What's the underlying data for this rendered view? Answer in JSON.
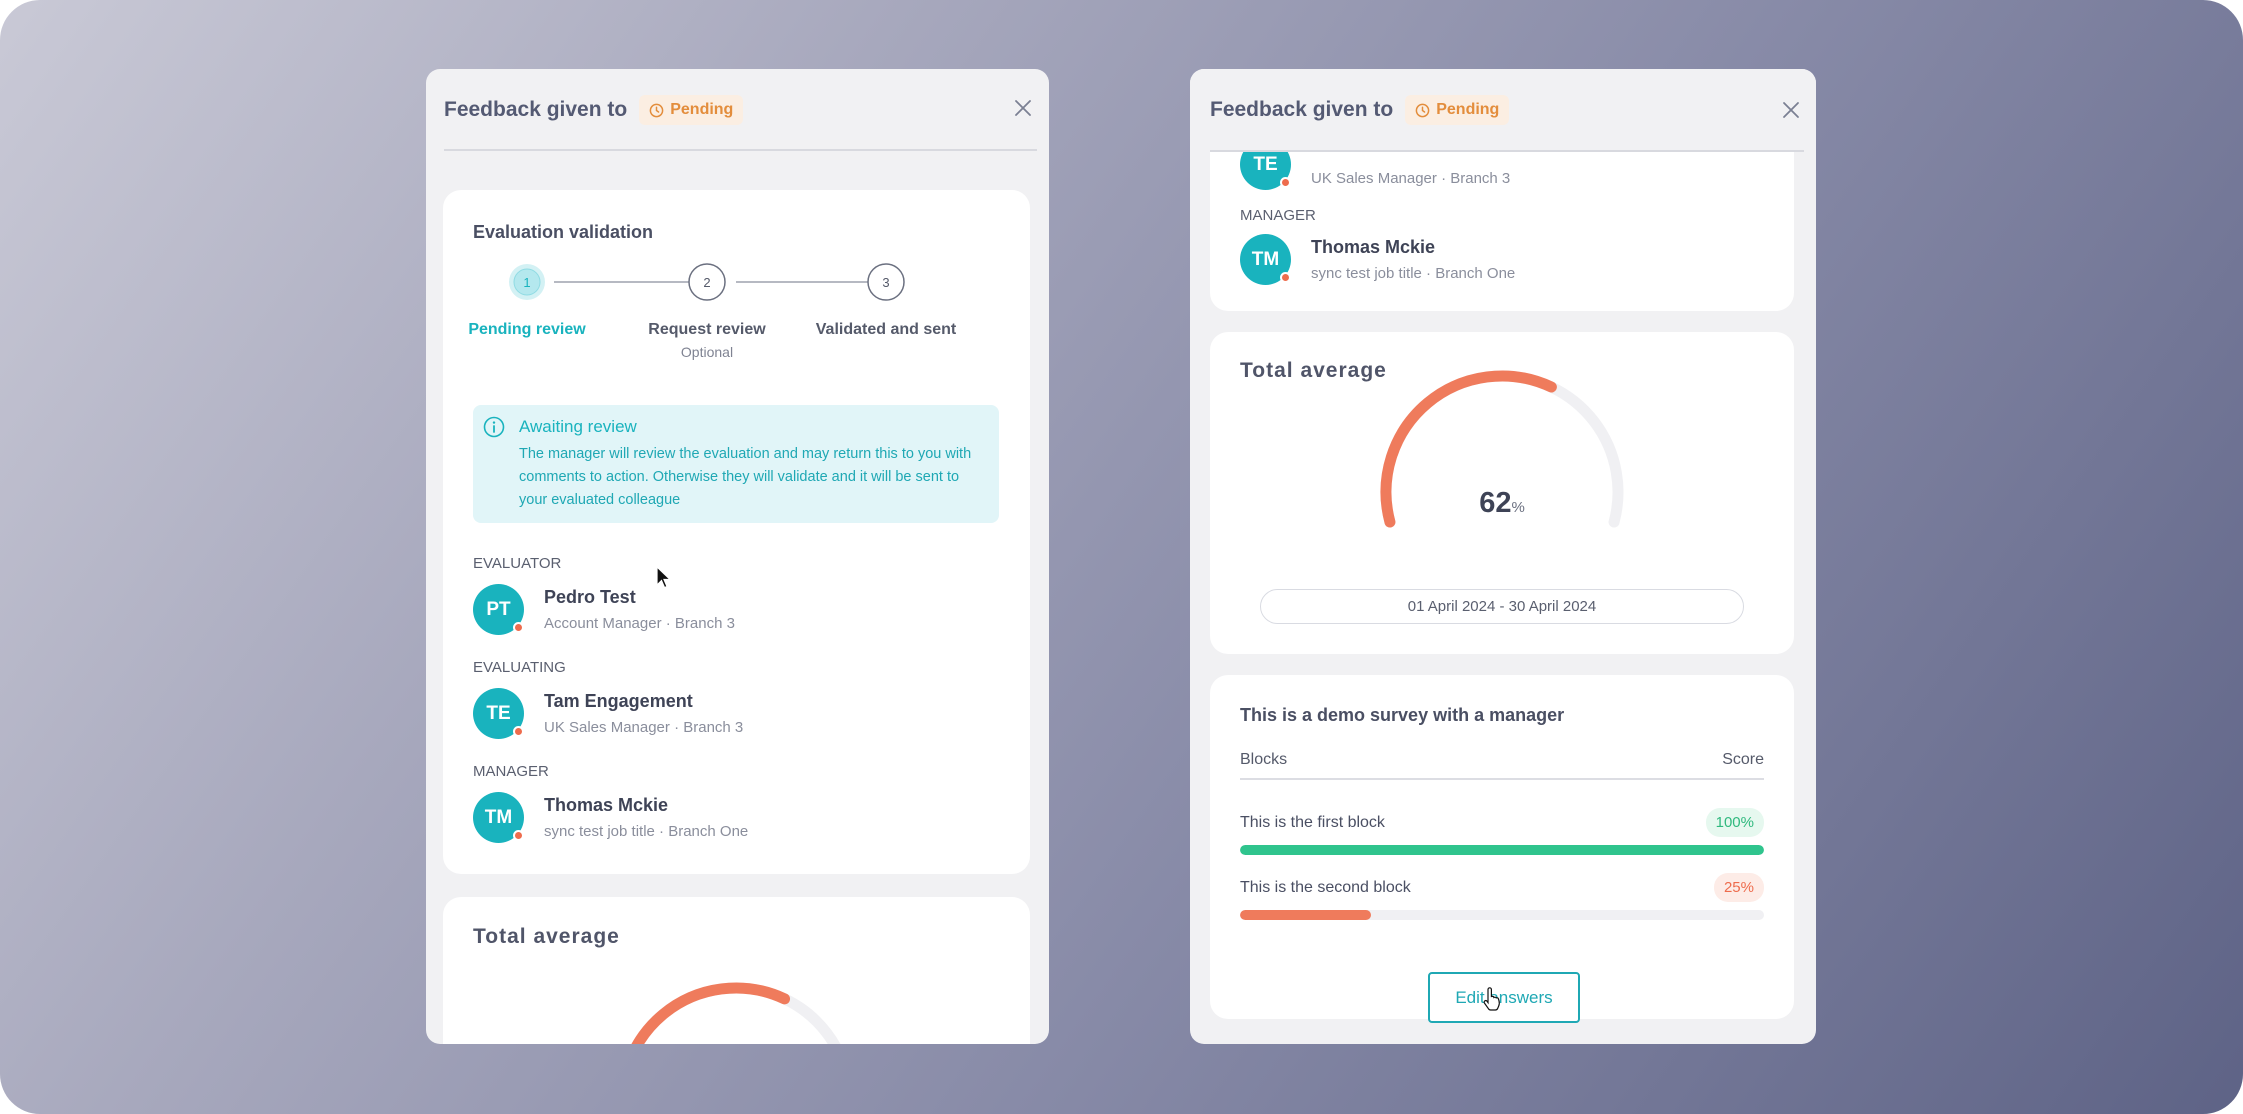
{
  "colors": {
    "accent": "#19b3be",
    "pending": "#e38d3c",
    "gauge": "#ef7b5c",
    "success": "#2fc48d",
    "danger": "#ee6c4d"
  },
  "left_panel": {
    "title": "Feedback given to",
    "status_badge": "Pending",
    "validation": {
      "title": "Evaluation validation",
      "steps": [
        {
          "number": "1",
          "label": "Pending review",
          "sub": "",
          "active": true
        },
        {
          "number": "2",
          "label": "Request review",
          "sub": "Optional",
          "active": false
        },
        {
          "number": "3",
          "label": "Validated and sent",
          "sub": "",
          "active": false
        }
      ],
      "alert": {
        "title": "Awaiting review",
        "text": "The manager will review the evaluation and may return this to you with comments to action. Otherwise they will validate and it will be sent to your evaluated colleague"
      },
      "evaluator": {
        "section": "EVALUATOR",
        "initials": "PT",
        "name": "Pedro Test",
        "role": "Account Manager · Branch 3"
      },
      "evaluating": {
        "section": "EVALUATING",
        "initials": "TE",
        "name": "Tam Engagement",
        "role": "UK Sales Manager · Branch 3"
      },
      "manager": {
        "section": "MANAGER",
        "initials": "TM",
        "name": "Thomas Mckie",
        "role": "sync test job title · Branch One"
      }
    },
    "total_average_title": "Total average",
    "gauge_percent": 62
  },
  "right_panel": {
    "title": "Feedback given to",
    "status_badge": "Pending",
    "evaluating": {
      "initials": "TE",
      "role": "UK Sales Manager · Branch 3"
    },
    "manager": {
      "section": "MANAGER",
      "initials": "TM",
      "name": "Thomas Mckie",
      "role": "sync test job title · Branch One"
    },
    "total_average": {
      "title": "Total average",
      "value": "62",
      "unit": "%",
      "percent": 62,
      "date_range": "01 April 2024 - 30 April 2024"
    },
    "survey": {
      "title": "This is a demo survey with a manager",
      "col_blocks": "Blocks",
      "col_score": "Score",
      "rows": [
        {
          "label": "This is the first block",
          "score": "100%",
          "percent": 100
        },
        {
          "label": "This is the second block",
          "score": "25%",
          "percent": 25
        }
      ]
    },
    "edit_button": "Edit answers"
  }
}
